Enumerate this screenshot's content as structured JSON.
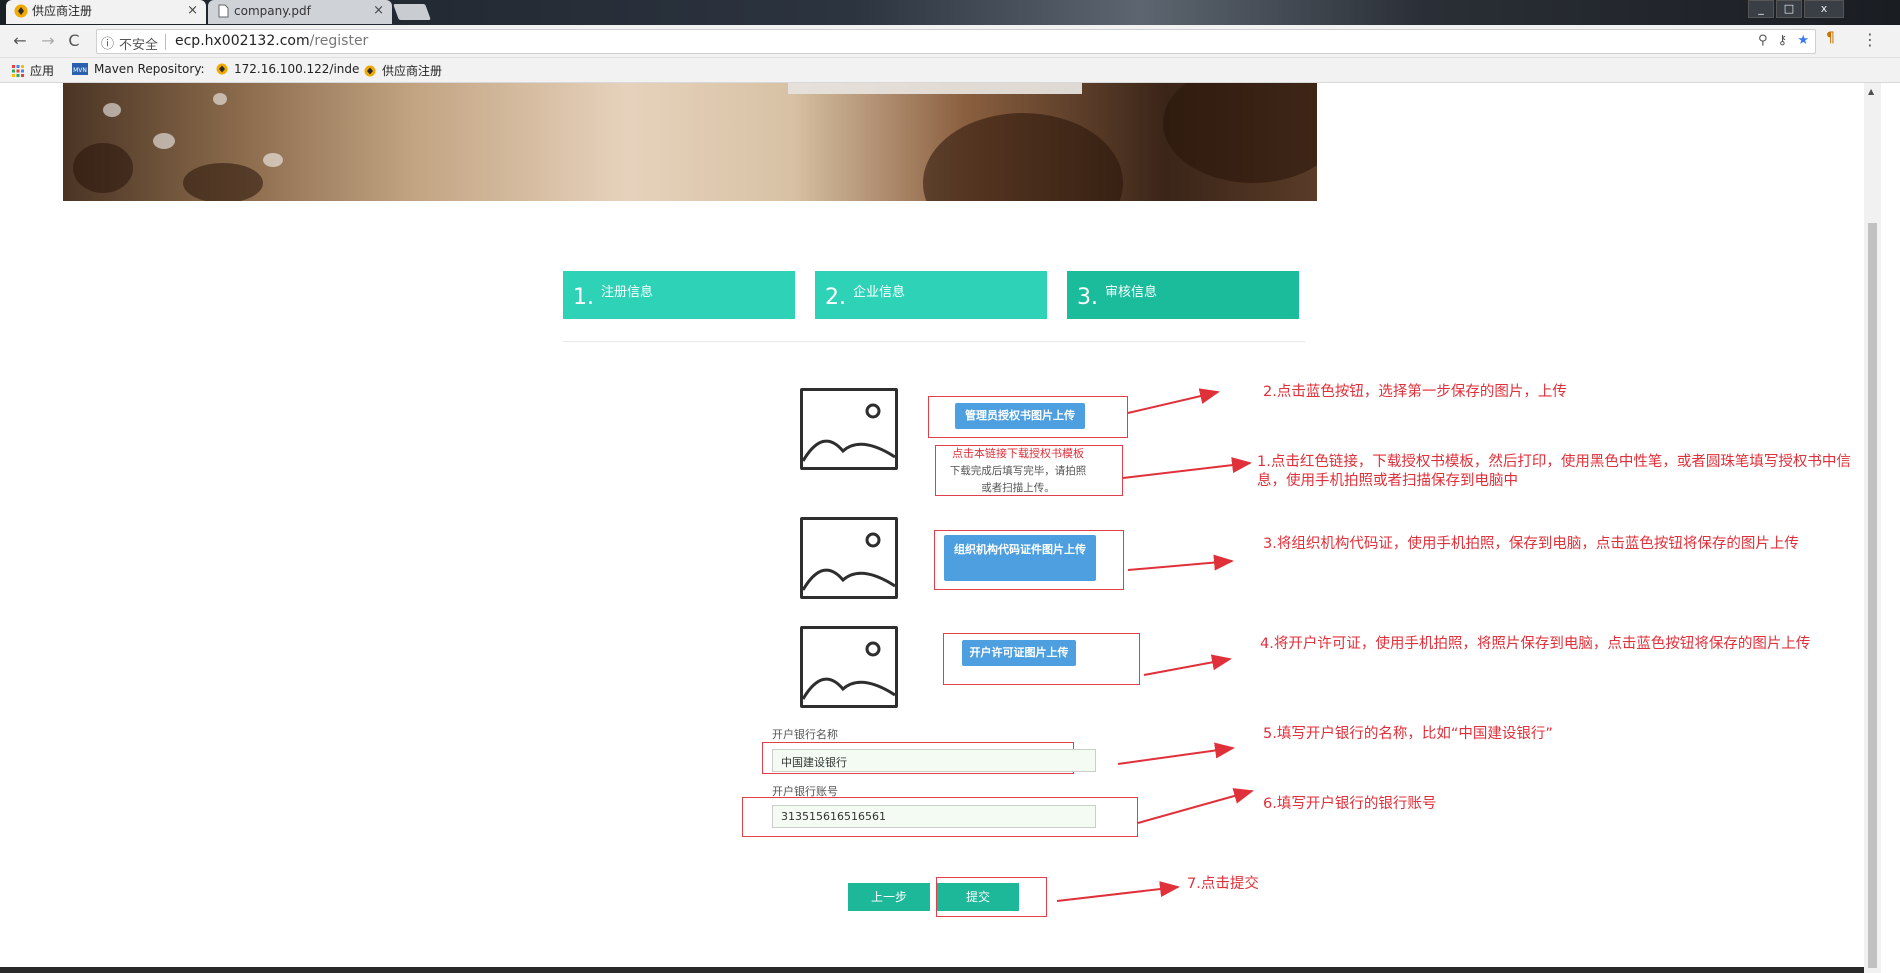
{
  "browser": {
    "tabs": [
      {
        "title": "供应商注册",
        "close": "×"
      },
      {
        "title": "company.pdf",
        "close": "×"
      }
    ],
    "window_controls": [
      "_",
      "□",
      "x"
    ],
    "address": {
      "security": "不安全",
      "host": "ecp.hx002132.com",
      "path": "/register"
    },
    "bookmarks": [
      {
        "label": "应用",
        "icon": "apps-grid-icon"
      },
      {
        "label": "Maven Repository:",
        "icon": "mvn-icon"
      },
      {
        "label": "172.16.100.122/inde",
        "icon": "site-logo-icon"
      },
      {
        "label": "供应商注册",
        "icon": "site-logo-icon"
      }
    ]
  },
  "steps": [
    {
      "num": "1.",
      "label": "注册信息"
    },
    {
      "num": "2.",
      "label": "企业信息"
    },
    {
      "num": "3.",
      "label": "审核信息"
    }
  ],
  "uploads": {
    "auth_button": "管理员授权书图片上传",
    "download_link": "点击本链接下载授权书模板",
    "download_hint": "下载完成后填写完毕，请拍照或者扫描上传。",
    "org_code_button": "组织机构代码证件图片上传",
    "permit_button": "开户许可证图片上传"
  },
  "form": {
    "bank_name_label": "开户银行名称",
    "bank_name_value": "中国建设银行",
    "bank_account_label": "开户银行账号",
    "bank_account_value": "313515616516561",
    "prev_button": "上一步",
    "submit_button": "提交"
  },
  "annotations": {
    "a1": "1.点击红色链接，下载授权书模板，然后打印，使用黑色中性笔，或者圆珠笔填写授权书中信息，使用手机拍照或者扫描保存到电脑中",
    "a2": "2.点击蓝色按钮，选择第一步保存的图片，上传",
    "a3": "3.将组织机构代码证，使用手机拍照，保存到电脑，点击蓝色按钮将保存的图片上传",
    "a4": "4.将开户许可证，使用手机拍照，将照片保存到电脑，点击蓝色按钮将保存的图片上传",
    "a5": "5.填写开户银行的名称，比如“中国建设银行”",
    "a6": "6.填写开户银行的银行账号",
    "a7": "7.点击提交"
  },
  "colors": {
    "step_active": "#2ed3b7",
    "step_last": "#1abc9c",
    "blue_button": "#4d9fe0",
    "green_button": "#1db899",
    "annotation_red": "#e0303a"
  }
}
